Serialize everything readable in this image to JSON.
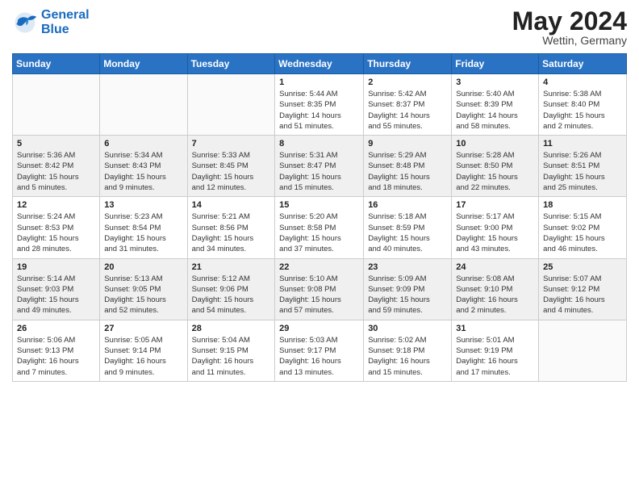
{
  "header": {
    "logo_line1": "General",
    "logo_line2": "Blue",
    "title": "May 2024",
    "location": "Wettin, Germany"
  },
  "weekdays": [
    "Sunday",
    "Monday",
    "Tuesday",
    "Wednesday",
    "Thursday",
    "Friday",
    "Saturday"
  ],
  "weeks": [
    [
      {
        "day": "",
        "info": ""
      },
      {
        "day": "",
        "info": ""
      },
      {
        "day": "",
        "info": ""
      },
      {
        "day": "1",
        "info": "Sunrise: 5:44 AM\nSunset: 8:35 PM\nDaylight: 14 hours\nand 51 minutes."
      },
      {
        "day": "2",
        "info": "Sunrise: 5:42 AM\nSunset: 8:37 PM\nDaylight: 14 hours\nand 55 minutes."
      },
      {
        "day": "3",
        "info": "Sunrise: 5:40 AM\nSunset: 8:39 PM\nDaylight: 14 hours\nand 58 minutes."
      },
      {
        "day": "4",
        "info": "Sunrise: 5:38 AM\nSunset: 8:40 PM\nDaylight: 15 hours\nand 2 minutes."
      }
    ],
    [
      {
        "day": "5",
        "info": "Sunrise: 5:36 AM\nSunset: 8:42 PM\nDaylight: 15 hours\nand 5 minutes."
      },
      {
        "day": "6",
        "info": "Sunrise: 5:34 AM\nSunset: 8:43 PM\nDaylight: 15 hours\nand 9 minutes."
      },
      {
        "day": "7",
        "info": "Sunrise: 5:33 AM\nSunset: 8:45 PM\nDaylight: 15 hours\nand 12 minutes."
      },
      {
        "day": "8",
        "info": "Sunrise: 5:31 AM\nSunset: 8:47 PM\nDaylight: 15 hours\nand 15 minutes."
      },
      {
        "day": "9",
        "info": "Sunrise: 5:29 AM\nSunset: 8:48 PM\nDaylight: 15 hours\nand 18 minutes."
      },
      {
        "day": "10",
        "info": "Sunrise: 5:28 AM\nSunset: 8:50 PM\nDaylight: 15 hours\nand 22 minutes."
      },
      {
        "day": "11",
        "info": "Sunrise: 5:26 AM\nSunset: 8:51 PM\nDaylight: 15 hours\nand 25 minutes."
      }
    ],
    [
      {
        "day": "12",
        "info": "Sunrise: 5:24 AM\nSunset: 8:53 PM\nDaylight: 15 hours\nand 28 minutes."
      },
      {
        "day": "13",
        "info": "Sunrise: 5:23 AM\nSunset: 8:54 PM\nDaylight: 15 hours\nand 31 minutes."
      },
      {
        "day": "14",
        "info": "Sunrise: 5:21 AM\nSunset: 8:56 PM\nDaylight: 15 hours\nand 34 minutes."
      },
      {
        "day": "15",
        "info": "Sunrise: 5:20 AM\nSunset: 8:58 PM\nDaylight: 15 hours\nand 37 minutes."
      },
      {
        "day": "16",
        "info": "Sunrise: 5:18 AM\nSunset: 8:59 PM\nDaylight: 15 hours\nand 40 minutes."
      },
      {
        "day": "17",
        "info": "Sunrise: 5:17 AM\nSunset: 9:00 PM\nDaylight: 15 hours\nand 43 minutes."
      },
      {
        "day": "18",
        "info": "Sunrise: 5:15 AM\nSunset: 9:02 PM\nDaylight: 15 hours\nand 46 minutes."
      }
    ],
    [
      {
        "day": "19",
        "info": "Sunrise: 5:14 AM\nSunset: 9:03 PM\nDaylight: 15 hours\nand 49 minutes."
      },
      {
        "day": "20",
        "info": "Sunrise: 5:13 AM\nSunset: 9:05 PM\nDaylight: 15 hours\nand 52 minutes."
      },
      {
        "day": "21",
        "info": "Sunrise: 5:12 AM\nSunset: 9:06 PM\nDaylight: 15 hours\nand 54 minutes."
      },
      {
        "day": "22",
        "info": "Sunrise: 5:10 AM\nSunset: 9:08 PM\nDaylight: 15 hours\nand 57 minutes."
      },
      {
        "day": "23",
        "info": "Sunrise: 5:09 AM\nSunset: 9:09 PM\nDaylight: 15 hours\nand 59 minutes."
      },
      {
        "day": "24",
        "info": "Sunrise: 5:08 AM\nSunset: 9:10 PM\nDaylight: 16 hours\nand 2 minutes."
      },
      {
        "day": "25",
        "info": "Sunrise: 5:07 AM\nSunset: 9:12 PM\nDaylight: 16 hours\nand 4 minutes."
      }
    ],
    [
      {
        "day": "26",
        "info": "Sunrise: 5:06 AM\nSunset: 9:13 PM\nDaylight: 16 hours\nand 7 minutes."
      },
      {
        "day": "27",
        "info": "Sunrise: 5:05 AM\nSunset: 9:14 PM\nDaylight: 16 hours\nand 9 minutes."
      },
      {
        "day": "28",
        "info": "Sunrise: 5:04 AM\nSunset: 9:15 PM\nDaylight: 16 hours\nand 11 minutes."
      },
      {
        "day": "29",
        "info": "Sunrise: 5:03 AM\nSunset: 9:17 PM\nDaylight: 16 hours\nand 13 minutes."
      },
      {
        "day": "30",
        "info": "Sunrise: 5:02 AM\nSunset: 9:18 PM\nDaylight: 16 hours\nand 15 minutes."
      },
      {
        "day": "31",
        "info": "Sunrise: 5:01 AM\nSunset: 9:19 PM\nDaylight: 16 hours\nand 17 minutes."
      },
      {
        "day": "",
        "info": ""
      }
    ]
  ]
}
